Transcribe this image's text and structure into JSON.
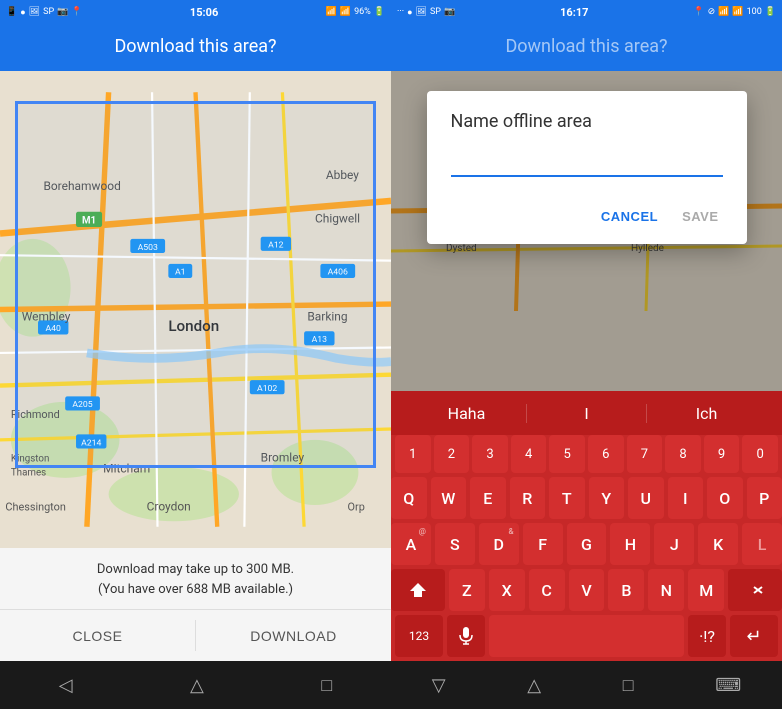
{
  "left": {
    "status_bar": {
      "left_icons": "📱 WhatsApp 🖼 SP ON 📷 🗂",
      "time": "15:06",
      "battery": "96%"
    },
    "header": {
      "title": "Download this area?"
    },
    "map": {
      "label": "London"
    },
    "download_info": {
      "line1": "Download may take up to 300 MB.",
      "line2": "(You have over 688 MB available.)"
    },
    "buttons": {
      "close": "CLOSE",
      "download": "DOWNLOAD"
    },
    "nav": {
      "back": "◁",
      "home": "△",
      "recent": "□"
    }
  },
  "right": {
    "status_bar": {
      "time": "16:17",
      "battery": "100"
    },
    "header": {
      "title": "Download this area?"
    },
    "dialog": {
      "title": "Name offline area",
      "input_value": "",
      "input_placeholder": "",
      "cancel_label": "CANCEL",
      "save_label": "SAVE"
    },
    "keyboard": {
      "suggestions": [
        "Haha",
        "I",
        "Ich"
      ],
      "num_row": [
        "1",
        "2",
        "3",
        "4",
        "5",
        "6",
        "7",
        "8",
        "9",
        "0"
      ],
      "row1": [
        "Q",
        "W",
        "E",
        "R",
        "T",
        "Y",
        "U",
        "I",
        "O",
        "P"
      ],
      "row1_sub": [
        "",
        "",
        "£",
        "",
        "",
        "",
        "",
        "",
        "",
        ""
      ],
      "row2": [
        "A",
        "S",
        "D",
        "F",
        "G",
        "H",
        "J",
        "K",
        "L"
      ],
      "row2_sub": [
        "@",
        "",
        "&",
        "",
        "",
        "",
        "",
        "",
        ""
      ],
      "row3": [
        "Z",
        "X",
        "C",
        "V",
        "B",
        "N",
        "M"
      ],
      "bottom": {
        "num": "123",
        "comma": ",",
        "space": "",
        "period": ".",
        "enter": "↵"
      }
    },
    "nav": {
      "back": "▽",
      "home": "△",
      "recent": "□",
      "keyboard": "⌨"
    }
  }
}
